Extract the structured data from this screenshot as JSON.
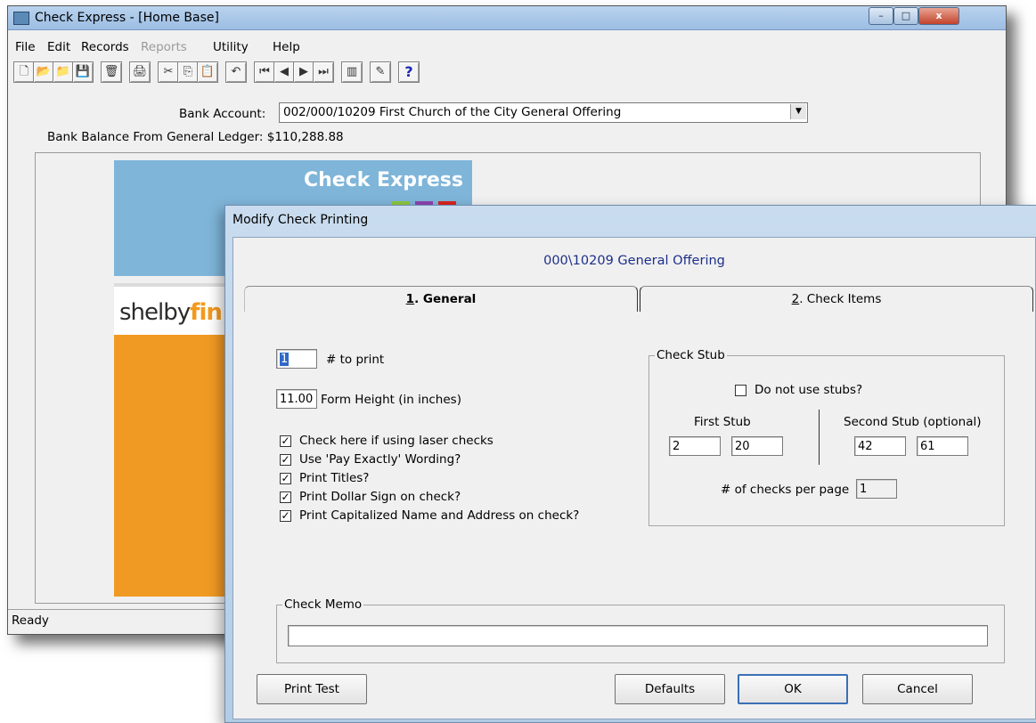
{
  "main_window": {
    "title": "Check Express - [Home Base]",
    "caption_buttons": {
      "minimize": "–",
      "maximize": "□",
      "close": "x"
    },
    "menu": [
      "File",
      "Edit",
      "Records",
      "Reports",
      "Utility",
      "Help"
    ],
    "menu_disabled": [
      "Reports"
    ],
    "toolbar": [
      "new",
      "open",
      "open-folder",
      "save",
      "delete",
      "print",
      "cut",
      "copy",
      "paste",
      "undo",
      "first",
      "previous",
      "next",
      "last",
      "chart",
      "edit-image",
      "help"
    ],
    "bank_account_label": "Bank Account:",
    "bank_account_value": "002/000/10209 First Church of the City General Offering",
    "balance_label": "Bank Balance From General Ledger: $110,288.88",
    "splash": {
      "title": "Check Express",
      "brand_prefix": "shelby",
      "brand_suffix": "fin"
    },
    "status": "Ready"
  },
  "dialog": {
    "title": "Modify Check Printing",
    "heading": "000\\10209 General Offering",
    "tabs": [
      {
        "label": "1. General",
        "key": "1",
        "rest": ". General",
        "active": true
      },
      {
        "label": "2. Check Items",
        "key": "2",
        "rest": ". Check Items",
        "active": false
      }
    ],
    "to_print_value": "1",
    "to_print_label": "# to print",
    "form_height_value": "11.00",
    "form_height_label": "Form Height (in inches)",
    "options": [
      {
        "label": "Check here if using laser checks",
        "checked": true
      },
      {
        "label": "Use 'Pay Exactly' Wording?",
        "checked": true
      },
      {
        "label": "Print Titles?",
        "checked": true
      },
      {
        "label": "Print Dollar Sign on check?",
        "checked": true
      },
      {
        "label": "Print Capitalized Name and Address on check?",
        "checked": true
      }
    ],
    "check_stub": {
      "legend": "Check Stub",
      "no_stubs_label": "Do not use stubs?",
      "no_stubs_checked": false,
      "first_stub_label": "First Stub",
      "first_stub_values": [
        "2",
        "20"
      ],
      "second_stub_label": "Second Stub (optional)",
      "second_stub_values": [
        "42",
        "61"
      ],
      "checks_per_page_label": "# of checks per page",
      "checks_per_page_value": "1"
    },
    "check_memo": {
      "legend": "Check Memo",
      "value": ""
    },
    "buttons": {
      "print_test": "Print Test",
      "defaults": "Defaults",
      "ok": "OK",
      "cancel": "Cancel"
    }
  },
  "icons": {
    "new": "🗋",
    "open": "📂",
    "open-folder": "📁",
    "save": "💾",
    "delete": "🗑",
    "print": "🖨",
    "cut": "✂",
    "copy": "⎘",
    "paste": "📋",
    "undo": "↶",
    "first": "⏮",
    "previous": "◀",
    "next": "▶",
    "last": "⏭",
    "chart": "▥",
    "edit-image": "✎",
    "help": "?"
  },
  "colors": {
    "titlebar": "#9cbde3",
    "splash_blue": "#7fb5d9",
    "splash_orange": "#f19a23",
    "heading_blue": "#1c2f8a",
    "squares": [
      "#8dc63f",
      "#8e44ad",
      "#d9241f"
    ]
  }
}
